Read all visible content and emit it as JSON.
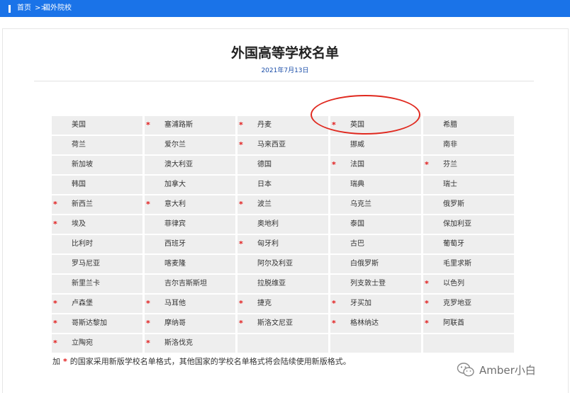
{
  "breadcrumb": {
    "home": "首页",
    "separator": ">>",
    "current": "国外院校"
  },
  "page": {
    "title": "外国高等学校名单",
    "date": "2021年7月13日"
  },
  "table": {
    "rows": [
      [
        {
          "name": "美国",
          "star": false
        },
        {
          "name": "塞浦路斯",
          "star": true
        },
        {
          "name": "丹麦",
          "star": true
        },
        {
          "name": "英国",
          "star": true
        },
        {
          "name": "希腊",
          "star": false
        }
      ],
      [
        {
          "name": "荷兰",
          "star": false
        },
        {
          "name": "爱尔兰",
          "star": false
        },
        {
          "name": "马来西亚",
          "star": true
        },
        {
          "name": "挪威",
          "star": false
        },
        {
          "name": "南非",
          "star": false
        }
      ],
      [
        {
          "name": "新加坡",
          "star": false
        },
        {
          "name": "澳大利亚",
          "star": false
        },
        {
          "name": "德国",
          "star": false
        },
        {
          "name": "法国",
          "star": true
        },
        {
          "name": "芬兰",
          "star": true
        }
      ],
      [
        {
          "name": "韩国",
          "star": false
        },
        {
          "name": "加拿大",
          "star": false
        },
        {
          "name": "日本",
          "star": false
        },
        {
          "name": "瑞典",
          "star": false
        },
        {
          "name": "瑞士",
          "star": false
        }
      ],
      [
        {
          "name": "新西兰",
          "star": true
        },
        {
          "name": "意大利",
          "star": true
        },
        {
          "name": "波兰",
          "star": true
        },
        {
          "name": "乌克兰",
          "star": false
        },
        {
          "name": "俄罗斯",
          "star": false
        }
      ],
      [
        {
          "name": "埃及",
          "star": true
        },
        {
          "name": "菲律宾",
          "star": false
        },
        {
          "name": "奥地利",
          "star": false
        },
        {
          "name": "泰国",
          "star": false
        },
        {
          "name": "保加利亚",
          "star": false
        }
      ],
      [
        {
          "name": "比利时",
          "star": false
        },
        {
          "name": "西班牙",
          "star": false
        },
        {
          "name": "匈牙利",
          "star": true
        },
        {
          "name": "古巴",
          "star": false
        },
        {
          "name": "葡萄牙",
          "star": false
        }
      ],
      [
        {
          "name": "罗马尼亚",
          "star": false
        },
        {
          "name": "喀麦隆",
          "star": false
        },
        {
          "name": "阿尔及利亚",
          "star": false
        },
        {
          "name": "白俄罗斯",
          "star": false
        },
        {
          "name": "毛里求斯",
          "star": false
        }
      ],
      [
        {
          "name": "新里兰卡",
          "star": false
        },
        {
          "name": "吉尔吉斯斯坦",
          "star": false
        },
        {
          "name": "拉脱维亚",
          "star": false
        },
        {
          "name": "列支敦士登",
          "star": false
        },
        {
          "name": "以色列",
          "star": true
        }
      ],
      [
        {
          "name": "卢森堡",
          "star": true
        },
        {
          "name": "马耳他",
          "star": true
        },
        {
          "name": "捷克",
          "star": true
        },
        {
          "name": "牙买加",
          "star": true
        },
        {
          "name": "克罗地亚",
          "star": true
        }
      ],
      [
        {
          "name": "哥斯达黎加",
          "star": true
        },
        {
          "name": "摩纳哥",
          "star": true
        },
        {
          "name": "斯洛文尼亚",
          "star": true
        },
        {
          "name": "格林纳达",
          "star": true
        },
        {
          "name": "阿联酋",
          "star": true
        }
      ],
      [
        {
          "name": "立陶宛",
          "star": true
        },
        {
          "name": "斯洛伐克",
          "star": true
        },
        {
          "name": "",
          "star": false
        },
        {
          "name": "",
          "star": false
        },
        {
          "name": "",
          "star": false
        }
      ]
    ],
    "star_symbol": "*"
  },
  "footnote": {
    "prefix": "加",
    "star": "*",
    "text": "的国家采用新版学校名单格式，其他国家的学校名单格式将会陆续使用新版格式。"
  },
  "watermark": {
    "text": "Amber小白",
    "icon": "wechat-icon"
  },
  "colors": {
    "topbar": "#1a73e8",
    "star": "#e21b1b",
    "annotation_oval": "#e0291f",
    "cell_bg": "#eeeeee"
  }
}
